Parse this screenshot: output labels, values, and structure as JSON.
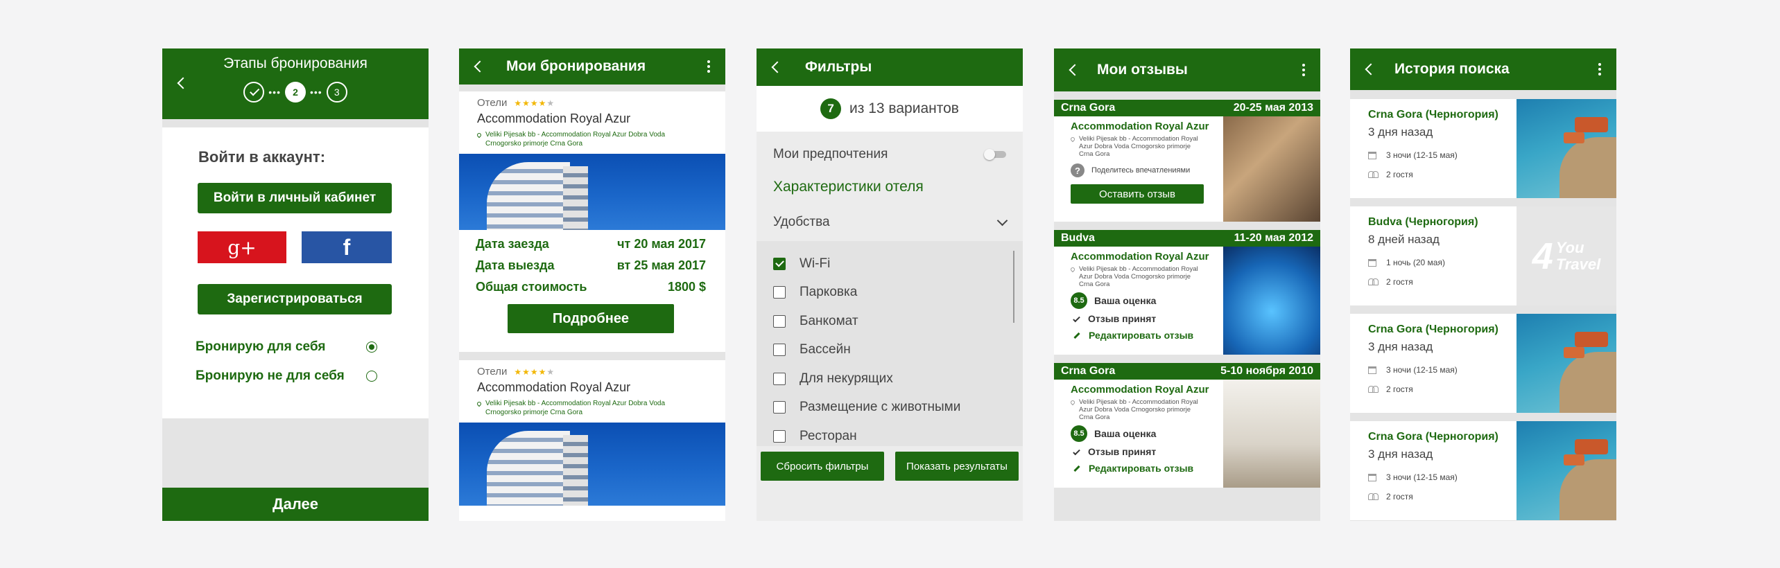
{
  "screen1": {
    "title": "Этапы бронирования",
    "steps": [
      "2",
      "3"
    ],
    "login_heading": "Войти в аккаунт:",
    "login_button": "Войти в личный кабинет",
    "google_label": "g+",
    "facebook_label": "f",
    "register_button": "Зарегистрироваться",
    "options": [
      "Бронирую для себя",
      "Бронирую не для себя"
    ],
    "selected_option": 0,
    "next_button": "Далее"
  },
  "screen2": {
    "title": "Мои бронирования",
    "cards": [
      {
        "category": "Отели",
        "stars": 4,
        "hotel": "Accommodation Royal Azur",
        "address": "Veliki Pijesak bb - Accommodation Royal Azur Dobra Voda Crnogorsko primorje Crna Gora",
        "rows": [
          {
            "label": "Дата заезда",
            "value": "чт 20 мая 2017"
          },
          {
            "label": "Дата выезда",
            "value": "вт 25 мая 2017"
          },
          {
            "label": "Общая стоимость",
            "value": "1800 $"
          }
        ],
        "button": "Подробнее"
      },
      {
        "category": "Отели",
        "stars": 4,
        "hotel": "Accommodation Royal Azur",
        "address": "Veliki Pijesak bb - Accommodation Royal Azur Dobra Voda Crnogorsko primorje Crna Gora"
      }
    ]
  },
  "screen3": {
    "title": "Фильтры",
    "count": "7",
    "count_text": "из 13 вариантов",
    "prefs_label": "Мои предпочтения",
    "section_title": "Характеристики отеля",
    "dropdown_label": "Удобства",
    "amenities": [
      {
        "label": "Wi-Fi",
        "checked": true
      },
      {
        "label": "Парковка",
        "checked": false
      },
      {
        "label": "Банкомат",
        "checked": false
      },
      {
        "label": "Бассейн",
        "checked": false
      },
      {
        "label": "Для некурящих",
        "checked": false
      },
      {
        "label": "Размещение с животными",
        "checked": false
      },
      {
        "label": "Ресторан",
        "checked": false
      }
    ],
    "reset_button": "Сбросить фильтры",
    "show_button": "Показать результаты"
  },
  "screen4": {
    "title": "Мои отзывы",
    "reviews": [
      {
        "country": "Crna Gora",
        "dates": "20-25 мая 2013",
        "hotel": "Accommodation Royal Azur",
        "address": "Veliki Pijesak bb - Accommodation Royal Azur Dobra Voda Crnogorsko primorje Crna Gora",
        "prompt_icon": "?",
        "prompt": "Поделитесь впечатлениями",
        "button": "Оставить отзыв"
      },
      {
        "country": "Budva",
        "dates": "11-20 мая 2012",
        "hotel": "Accommodation Royal Azur",
        "address": "Veliki Pijesak bb - Accommodation Royal Azur Dobra Voda Crnogorsko primorje Crna Gora",
        "score": "8.5",
        "score_label": "Ваша оценка",
        "accepted": "Отзыв принят",
        "edit": "Редактировать отзыв"
      },
      {
        "country": "Crna Gora",
        "dates": "5-10 ноября 2010",
        "hotel": "Accommodation Royal Azur",
        "address": "Veliki Pijesak bb - Accommodation Royal Azur Dobra Voda Crnogorsko primorje Crna Gora",
        "score": "8.5",
        "score_label": "Ваша оценка",
        "accepted": "Отзыв принят",
        "edit": "Редактировать отзыв"
      }
    ]
  },
  "screen5": {
    "title": "История поиска",
    "items": [
      {
        "place": "Crna Gora (Черногория)",
        "ago": "3 дня назад",
        "nights": "3 ночи (12-15 мая)",
        "guests": "2 гостя",
        "photo": true
      },
      {
        "place": "Budva (Черногория)",
        "ago": "8 дней назад",
        "nights": "1 ночь (20 мая)",
        "guests": "2 гостя",
        "photo": false,
        "logo_num": "4",
        "logo_a": "You",
        "logo_b": "Travel"
      },
      {
        "place": "Crna Gora (Черногория)",
        "ago": "3 дня назад",
        "nights": "3 ночи (12-15 мая)",
        "guests": "2 гостя",
        "photo": true
      },
      {
        "place": "Crna Gora (Черногория)",
        "ago": "3 дня назад",
        "nights": "3 ночи (12-15 мая)",
        "guests": "2 гостя",
        "photo": true
      }
    ]
  },
  "colors": {
    "primary": "#1e6a11",
    "google": "#d7141d",
    "facebook": "#2855a4",
    "star": "#f2b705"
  }
}
